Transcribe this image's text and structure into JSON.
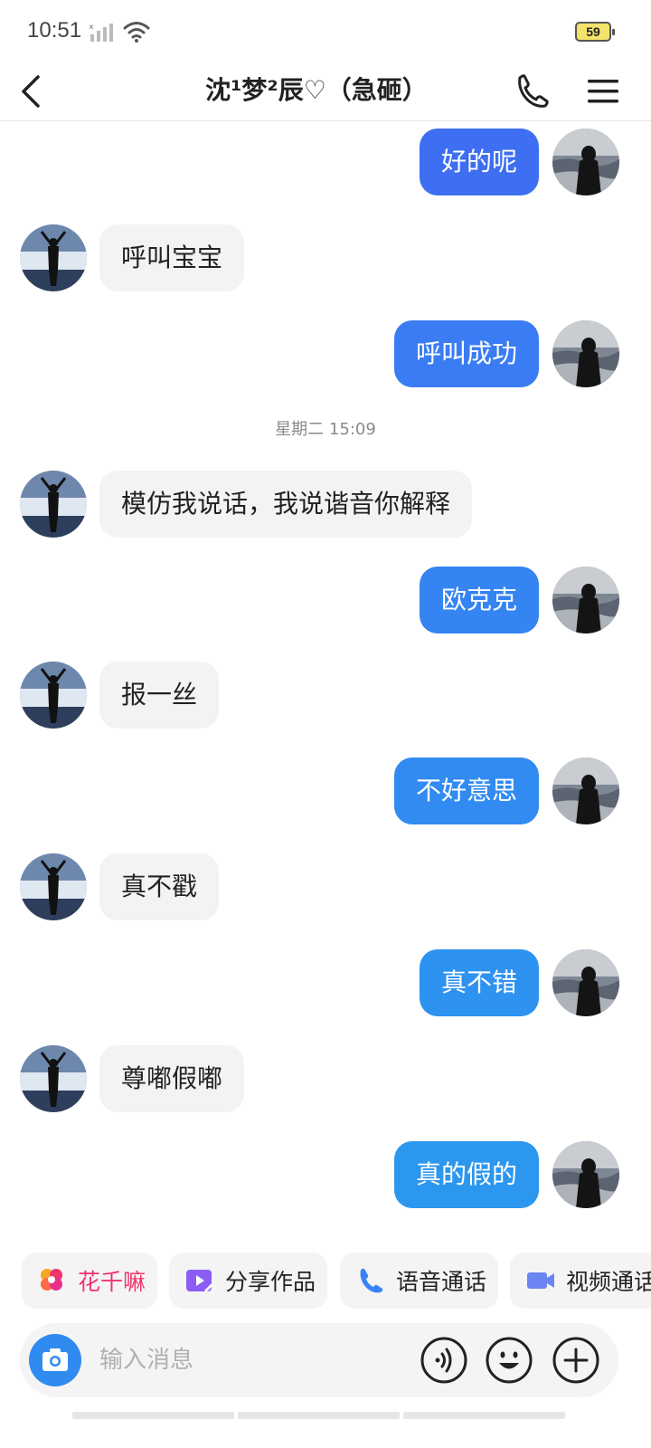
{
  "status_bar": {
    "time": "10:51",
    "battery": "59"
  },
  "header": {
    "title": "沈¹梦²辰♡（急砸）",
    "back_icon": "chevron-left-icon",
    "call_icon": "phone-icon",
    "menu_icon": "menu-icon"
  },
  "messages": [
    {
      "side": "right",
      "text": "好的呢",
      "color": "#3e6ff2"
    },
    {
      "side": "left",
      "text": "呼叫宝宝"
    },
    {
      "side": "right",
      "text": "呼叫成功",
      "color": "#3a7cf3"
    },
    {
      "type": "time",
      "text": "星期二 15:09"
    },
    {
      "side": "left",
      "text": "模仿我说话，我说谐音你解释"
    },
    {
      "side": "right",
      "text": "欧克克",
      "color": "#3484f2"
    },
    {
      "side": "left",
      "text": "报一丝"
    },
    {
      "side": "right",
      "text": "不好意思",
      "color": "#318bf1"
    },
    {
      "side": "left",
      "text": "真不戳"
    },
    {
      "side": "right",
      "text": "真不错",
      "color": "#2e92f0"
    },
    {
      "side": "left",
      "text": "尊嘟假嘟"
    },
    {
      "side": "right",
      "text": "真的假的",
      "color": "#2c97ef"
    }
  ],
  "quick_actions": [
    {
      "label": "花千嘛",
      "icon": "flower-icon",
      "color": "#f0346f"
    },
    {
      "label": "分享作品",
      "icon": "video-share-icon",
      "color": "#222222"
    },
    {
      "label": "语音通话",
      "icon": "phone-icon",
      "color": "#222222"
    },
    {
      "label": "视频通话",
      "icon": "video-camera-icon",
      "color": "#222222"
    }
  ],
  "input": {
    "placeholder": "输入消息",
    "camera_icon": "camera-icon",
    "voice_icon": "voice-icon",
    "emoji_icon": "emoji-icon",
    "plus_icon": "plus-icon"
  },
  "colors": {
    "accent": "#2f8bf0",
    "bubble_left": "#f3f3f3"
  }
}
